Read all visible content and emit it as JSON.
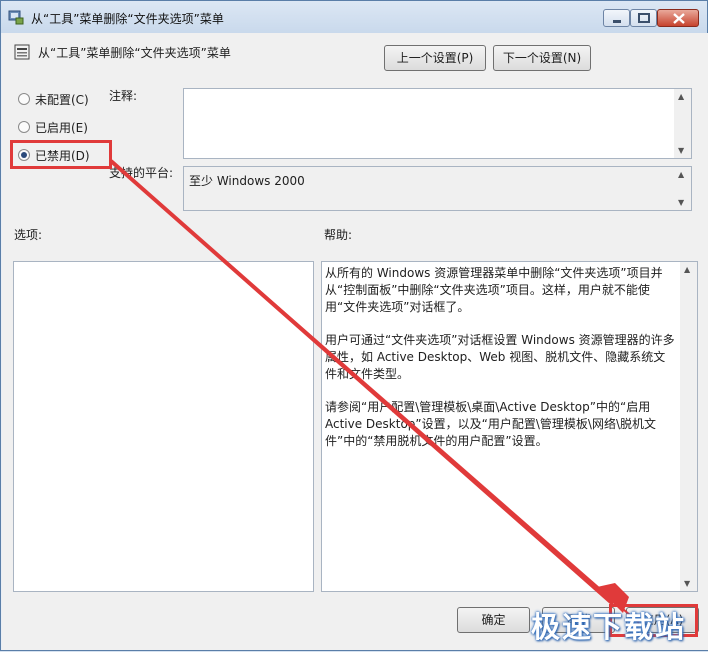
{
  "window": {
    "title": "从“工具”菜单删除“文件夹选项”菜单"
  },
  "policy": {
    "name": "从“工具”菜单删除“文件夹选项”菜单",
    "prev_label": "上一个设置(P)",
    "next_label": "下一个设置(N)"
  },
  "state": {
    "options": [
      {
        "label": "未配置(C)",
        "checked": false
      },
      {
        "label": "已启用(E)",
        "checked": false
      },
      {
        "label": "已禁用(D)",
        "checked": true
      }
    ]
  },
  "comment": {
    "label": "注释:",
    "value": ""
  },
  "platform": {
    "label": "支持的平台:",
    "value": "至少 Windows 2000"
  },
  "options_panel": {
    "label": "选项:"
  },
  "help": {
    "label": "帮助:",
    "paragraphs": [
      "从所有的 Windows 资源管理器菜单中删除“文件夹选项”项目并从“控制面板”中删除“文件夹选项”项目。这样，用户就不能使用“文件夹选项”对话框了。",
      "用户可通过“文件夹选项”对话框设置 Windows 资源管理器的许多属性，如 Active Desktop、Web 视图、脱机文件、隐藏系统文件和文件类型。",
      "请参阅“用户配置\\管理模板\\桌面\\Active Desktop”中的“启用 Active Desktop”设置，以及“用户配置\\管理模板\\网络\\脱机文件”中的“禁用脱机文件的用户配置”设置。"
    ]
  },
  "footer": {
    "ok_label": "确定",
    "cancel_label": "取消",
    "apply_label": "应用(A)"
  },
  "watermark": "极速下载站",
  "colors": {
    "annotation_red": "#e03a3a",
    "window_border": "#5a7ea8"
  }
}
